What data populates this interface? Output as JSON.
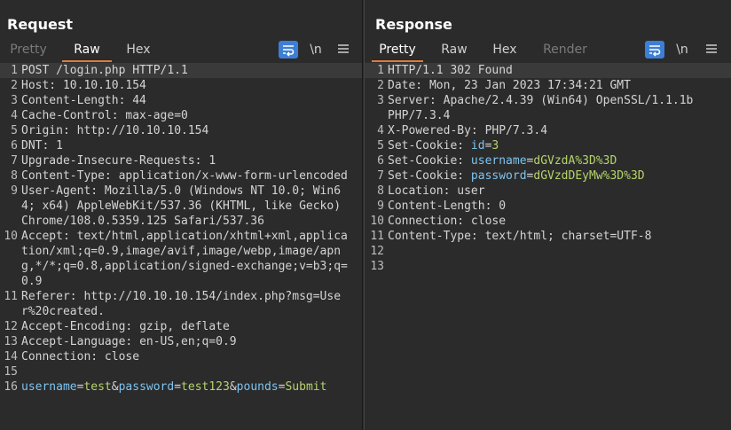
{
  "request": {
    "title": "Request",
    "tabs": [
      "Pretty",
      "Raw",
      "Hex"
    ],
    "newline_label": "\\n",
    "lines": [
      {
        "n": "1",
        "parts": [
          {
            "t": "POST /login.php HTTP/1.1",
            "c": "val"
          }
        ]
      },
      {
        "n": "2",
        "parts": [
          {
            "t": "Host: ",
            "c": "key"
          },
          {
            "t": "10.10.10.154",
            "c": "val"
          }
        ]
      },
      {
        "n": "3",
        "parts": [
          {
            "t": "Content-Length: ",
            "c": "key"
          },
          {
            "t": "44",
            "c": "val"
          }
        ]
      },
      {
        "n": "4",
        "parts": [
          {
            "t": "Cache-Control: ",
            "c": "key"
          },
          {
            "t": "max-age=0",
            "c": "val"
          }
        ]
      },
      {
        "n": "5",
        "parts": [
          {
            "t": "Origin: ",
            "c": "key"
          },
          {
            "t": "http://10.10.10.154",
            "c": "val"
          }
        ]
      },
      {
        "n": "6",
        "parts": [
          {
            "t": "DNT: ",
            "c": "key"
          },
          {
            "t": "1",
            "c": "val"
          }
        ]
      },
      {
        "n": "7",
        "parts": [
          {
            "t": "Upgrade-Insecure-Requests: ",
            "c": "key"
          },
          {
            "t": "1",
            "c": "val"
          }
        ]
      },
      {
        "n": "8",
        "parts": [
          {
            "t": "Content-Type: ",
            "c": "key"
          },
          {
            "t": "application/x-www-form-urlencoded",
            "c": "val"
          }
        ]
      },
      {
        "n": "9",
        "parts": [
          {
            "t": "User-Agent: ",
            "c": "key"
          },
          {
            "t": "Mozilla/5.0 (Windows NT 10.0; Win64; x64) AppleWebKit/537.36 (KHTML, like Gecko) Chrome/108.0.5359.125 Safari/537.36",
            "c": "val"
          }
        ]
      },
      {
        "n": "10",
        "parts": [
          {
            "t": "Accept: ",
            "c": "key"
          },
          {
            "t": "text/html,application/xhtml+xml,application/xml;q=0.9,image/avif,image/webp,image/apng,*/*;q=0.8,application/signed-exchange;v=b3;q=0.9",
            "c": "val"
          }
        ]
      },
      {
        "n": "11",
        "parts": [
          {
            "t": "Referer: ",
            "c": "key"
          },
          {
            "t": "http://10.10.10.154/index.php?msg=User%20created.",
            "c": "val"
          }
        ]
      },
      {
        "n": "12",
        "parts": [
          {
            "t": "Accept-Encoding: ",
            "c": "key"
          },
          {
            "t": "gzip, deflate",
            "c": "val"
          }
        ]
      },
      {
        "n": "13",
        "parts": [
          {
            "t": "Accept-Language: ",
            "c": "key"
          },
          {
            "t": "en-US,en;q=0.9",
            "c": "val"
          }
        ]
      },
      {
        "n": "14",
        "parts": [
          {
            "t": "Connection: ",
            "c": "key"
          },
          {
            "t": "close",
            "c": "val"
          }
        ]
      },
      {
        "n": "15",
        "parts": []
      },
      {
        "n": "16",
        "parts": [
          {
            "t": "username",
            "c": "pk"
          },
          {
            "t": "=",
            "c": "val"
          },
          {
            "t": "test",
            "c": "pv"
          },
          {
            "t": "&",
            "c": "val"
          },
          {
            "t": "password",
            "c": "pk"
          },
          {
            "t": "=",
            "c": "val"
          },
          {
            "t": "test123",
            "c": "pv"
          },
          {
            "t": "&",
            "c": "val"
          },
          {
            "t": "pounds",
            "c": "pk"
          },
          {
            "t": "=",
            "c": "val"
          },
          {
            "t": "Submit",
            "c": "pv"
          }
        ]
      }
    ]
  },
  "response": {
    "title": "Response",
    "tabs": [
      "Pretty",
      "Raw",
      "Hex",
      "Render"
    ],
    "newline_label": "\\n",
    "lines": [
      {
        "n": "1",
        "parts": [
          {
            "t": "HTTP/1.1 302 Found",
            "c": "val"
          }
        ]
      },
      {
        "n": "2",
        "parts": [
          {
            "t": "Date: ",
            "c": "key"
          },
          {
            "t": "Mon, 23 Jan 2023 17:34:21 GMT",
            "c": "val"
          }
        ]
      },
      {
        "n": "3",
        "parts": [
          {
            "t": "Server: ",
            "c": "key"
          },
          {
            "t": "Apache/2.4.39 (Win64) OpenSSL/1.1.1b PHP/7.3.4",
            "c": "val"
          }
        ]
      },
      {
        "n": "4",
        "parts": [
          {
            "t": "X-Powered-By: ",
            "c": "key"
          },
          {
            "t": "PHP/7.3.4",
            "c": "val"
          }
        ]
      },
      {
        "n": "5",
        "parts": [
          {
            "t": "Set-Cookie: ",
            "c": "key"
          },
          {
            "t": "id",
            "c": "pk"
          },
          {
            "t": "=",
            "c": "val"
          },
          {
            "t": "3",
            "c": "pv"
          }
        ]
      },
      {
        "n": "6",
        "parts": [
          {
            "t": "Set-Cookie: ",
            "c": "key"
          },
          {
            "t": "username",
            "c": "pk"
          },
          {
            "t": "=",
            "c": "val"
          },
          {
            "t": "dGVzdA%3D%3D",
            "c": "pv"
          }
        ]
      },
      {
        "n": "7",
        "parts": [
          {
            "t": "Set-Cookie: ",
            "c": "key"
          },
          {
            "t": "password",
            "c": "pk"
          },
          {
            "t": "=",
            "c": "val"
          },
          {
            "t": "dGVzdDEyMw%3D%3D",
            "c": "pv"
          }
        ]
      },
      {
        "n": "8",
        "parts": [
          {
            "t": "Location: ",
            "c": "key"
          },
          {
            "t": "user",
            "c": "val"
          }
        ]
      },
      {
        "n": "9",
        "parts": [
          {
            "t": "Content-Length: ",
            "c": "key"
          },
          {
            "t": "0",
            "c": "val"
          }
        ]
      },
      {
        "n": "10",
        "parts": [
          {
            "t": "Connection: ",
            "c": "key"
          },
          {
            "t": "close",
            "c": "val"
          }
        ]
      },
      {
        "n": "11",
        "parts": [
          {
            "t": "Content-Type: ",
            "c": "key"
          },
          {
            "t": "text/html; charset=UTF-8",
            "c": "val"
          }
        ]
      },
      {
        "n": "12",
        "parts": []
      },
      {
        "n": "13",
        "parts": []
      }
    ]
  },
  "icons": {
    "wrap": "wrap-lines-icon",
    "menu": "hamburger-menu-icon",
    "layout_side": "layout-side-by-side-icon",
    "layout_vertical": "layout-stacked-icon",
    "layout_single": "layout-single-icon"
  },
  "colors": {
    "accent_blue": "#3d7fd6",
    "active_tab_underline": "#e07b3a",
    "param_name": "#7ec3ef",
    "param_value": "#b5d46a"
  }
}
